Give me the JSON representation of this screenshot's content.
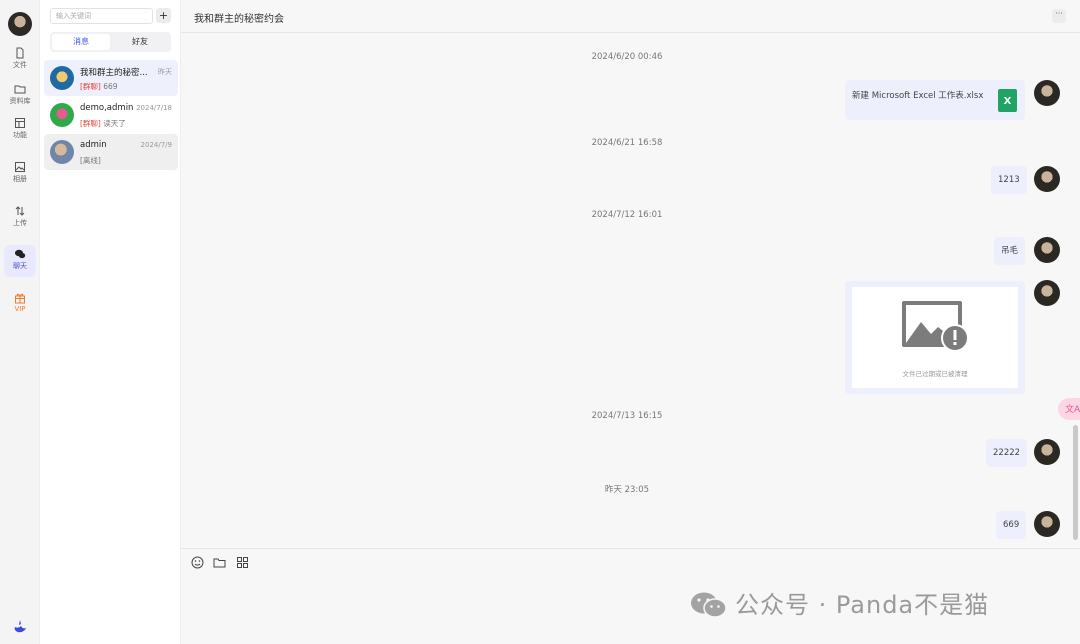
{
  "rail": {
    "items": [
      {
        "label": "文件",
        "icon": "file-icon"
      },
      {
        "label": "资料库",
        "icon": "folder-icon"
      },
      {
        "label": "功能",
        "icon": "layout-icon"
      },
      {
        "label": "相册",
        "icon": "image-icon"
      },
      {
        "label": "上传",
        "icon": "transfer-icon"
      },
      {
        "label": "聊天",
        "icon": "chat-icon"
      },
      {
        "label": "VIP",
        "icon": "gift-icon"
      }
    ]
  },
  "sidebar": {
    "search_placeholder": "输入关键词",
    "add_label": "+",
    "tabs": [
      "消息",
      "好友"
    ],
    "conversations": [
      {
        "name": "我和群主的秘密...",
        "time": "昨天",
        "tag": "[群聊]",
        "preview": " 669",
        "avatar_color": "#1f6aa5"
      },
      {
        "name": "demo,admin",
        "time": "2024/7/18",
        "tag": "[群聊]",
        "preview": " 读天了",
        "avatar_color": "#2faa4a"
      },
      {
        "name": "admin",
        "time": "2024/7/9",
        "tag": "",
        "preview": "[离线]",
        "avatar_color": "#8a7f78"
      }
    ]
  },
  "header": {
    "title": "我和群主的秘密约会",
    "more_label": "···"
  },
  "messages": {
    "ts1": "2024/6/20 00:46",
    "file_name": "新建 Microsoft Excel 工作表.xlsx",
    "file_icon_label": "X",
    "ts2": "2024/6/21 16:58",
    "msg_1213": "1213",
    "ts3": "2024/7/12 16:01",
    "msg_fm": "吊毛",
    "image_caption": "文件已过期或已被清理",
    "ts4": "2024/7/13 16:15",
    "msg_22222": "22222",
    "ts5": "昨天 23:05",
    "msg_669": "669"
  },
  "float_label": "文A",
  "input": {
    "tools": [
      "emoji-icon",
      "folder-icon",
      "apps-icon"
    ]
  },
  "watermark": "公众号 · Panda不是猫",
  "colors": {
    "accent": "#3c57e6",
    "bubble": "#eeeffd",
    "vip": "#e87d2c",
    "group_tag": "#e0473a",
    "excel": "#21a366"
  }
}
